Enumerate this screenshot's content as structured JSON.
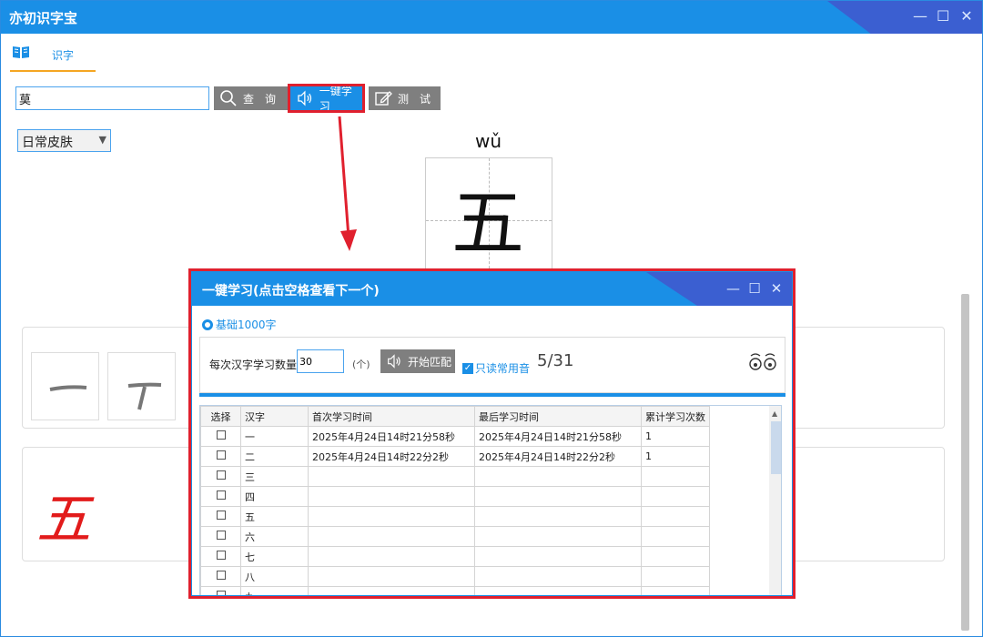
{
  "app": {
    "title": "亦初识字宝"
  },
  "window_controls": {
    "minimize": "—",
    "maximize": "☐",
    "close": "✕"
  },
  "tab": {
    "label": "识字",
    "icon": "book-icon"
  },
  "search": {
    "value": "莫"
  },
  "toolbar": {
    "query_label": "查　询",
    "learn_label": "一键学习",
    "test_label": "测　试"
  },
  "skin": {
    "selected": "日常皮肤"
  },
  "character": {
    "pinyin": "wǔ",
    "char": "五",
    "written_char": "五"
  },
  "dialog": {
    "title": "一键学习(点击空格查看下一个)",
    "radio_label": "基础1000字",
    "count_label": "每次汉字学习数量:",
    "count_value": "30",
    "unit_label": "(个)",
    "match_button": "开始匹配",
    "checkbox_label": "只读常用音",
    "progress": "5/31",
    "columns": [
      "选择",
      "汉字",
      "首次学习时间",
      "最后学习时间",
      "累计学习次数"
    ],
    "rows": [
      {
        "char": "一",
        "first": "2025年4月24日14时21分58秒",
        "last": "2025年4月24日14时21分58秒",
        "count": "1"
      },
      {
        "char": "二",
        "first": "2025年4月24日14时22分2秒",
        "last": "2025年4月24日14时22分2秒",
        "count": "1"
      },
      {
        "char": "三",
        "first": "",
        "last": "",
        "count": ""
      },
      {
        "char": "四",
        "first": "",
        "last": "",
        "count": ""
      },
      {
        "char": "五",
        "first": "",
        "last": "",
        "count": ""
      },
      {
        "char": "六",
        "first": "",
        "last": "",
        "count": ""
      },
      {
        "char": "七",
        "first": "",
        "last": "",
        "count": ""
      },
      {
        "char": "八",
        "first": "",
        "last": "",
        "count": ""
      },
      {
        "char": "九",
        "first": "",
        "last": "",
        "count": ""
      }
    ]
  },
  "colors": {
    "accent": "#1a8fe6",
    "highlight": "#e0202e",
    "tab_underline": "#f5a623",
    "written_char": "#e21b1b"
  }
}
